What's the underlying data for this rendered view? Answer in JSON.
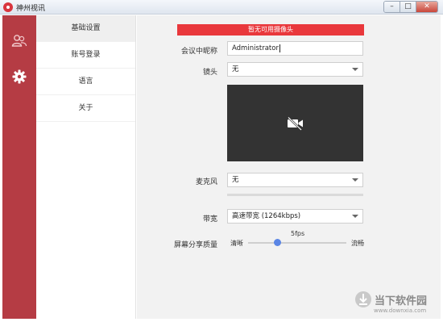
{
  "window": {
    "title": "神州视讯",
    "controls": [
      "–",
      "□",
      "✕"
    ]
  },
  "rail": {
    "items": [
      {
        "icon": "contacts-icon"
      },
      {
        "icon": "gear-icon"
      }
    ]
  },
  "menu": {
    "items": [
      {
        "label": "基础设置",
        "active": true
      },
      {
        "label": "账号登录"
      },
      {
        "label": "语言"
      },
      {
        "label": "关于"
      }
    ]
  },
  "settings": {
    "banner": "暂无可用摄像头",
    "nickname_label": "会议中昵称",
    "nickname_value": "Administrator",
    "camera_label": "镜头",
    "camera_value": "无",
    "mic_label": "麦克风",
    "mic_value": "无",
    "bandwidth_label": "带宽",
    "bandwidth_value": "高速带宽 (1264kbps)",
    "share_label": "屏幕分享质量",
    "share_fps": "5fps",
    "share_left": "清晰",
    "share_right": "流畅",
    "share_level": 0.3
  },
  "watermark": {
    "text": "当下软件园",
    "url": "www.downxia.com"
  },
  "colors": {
    "accent": "#b53c44",
    "banner": "#e9383c",
    "slider": "#5b86e5"
  }
}
